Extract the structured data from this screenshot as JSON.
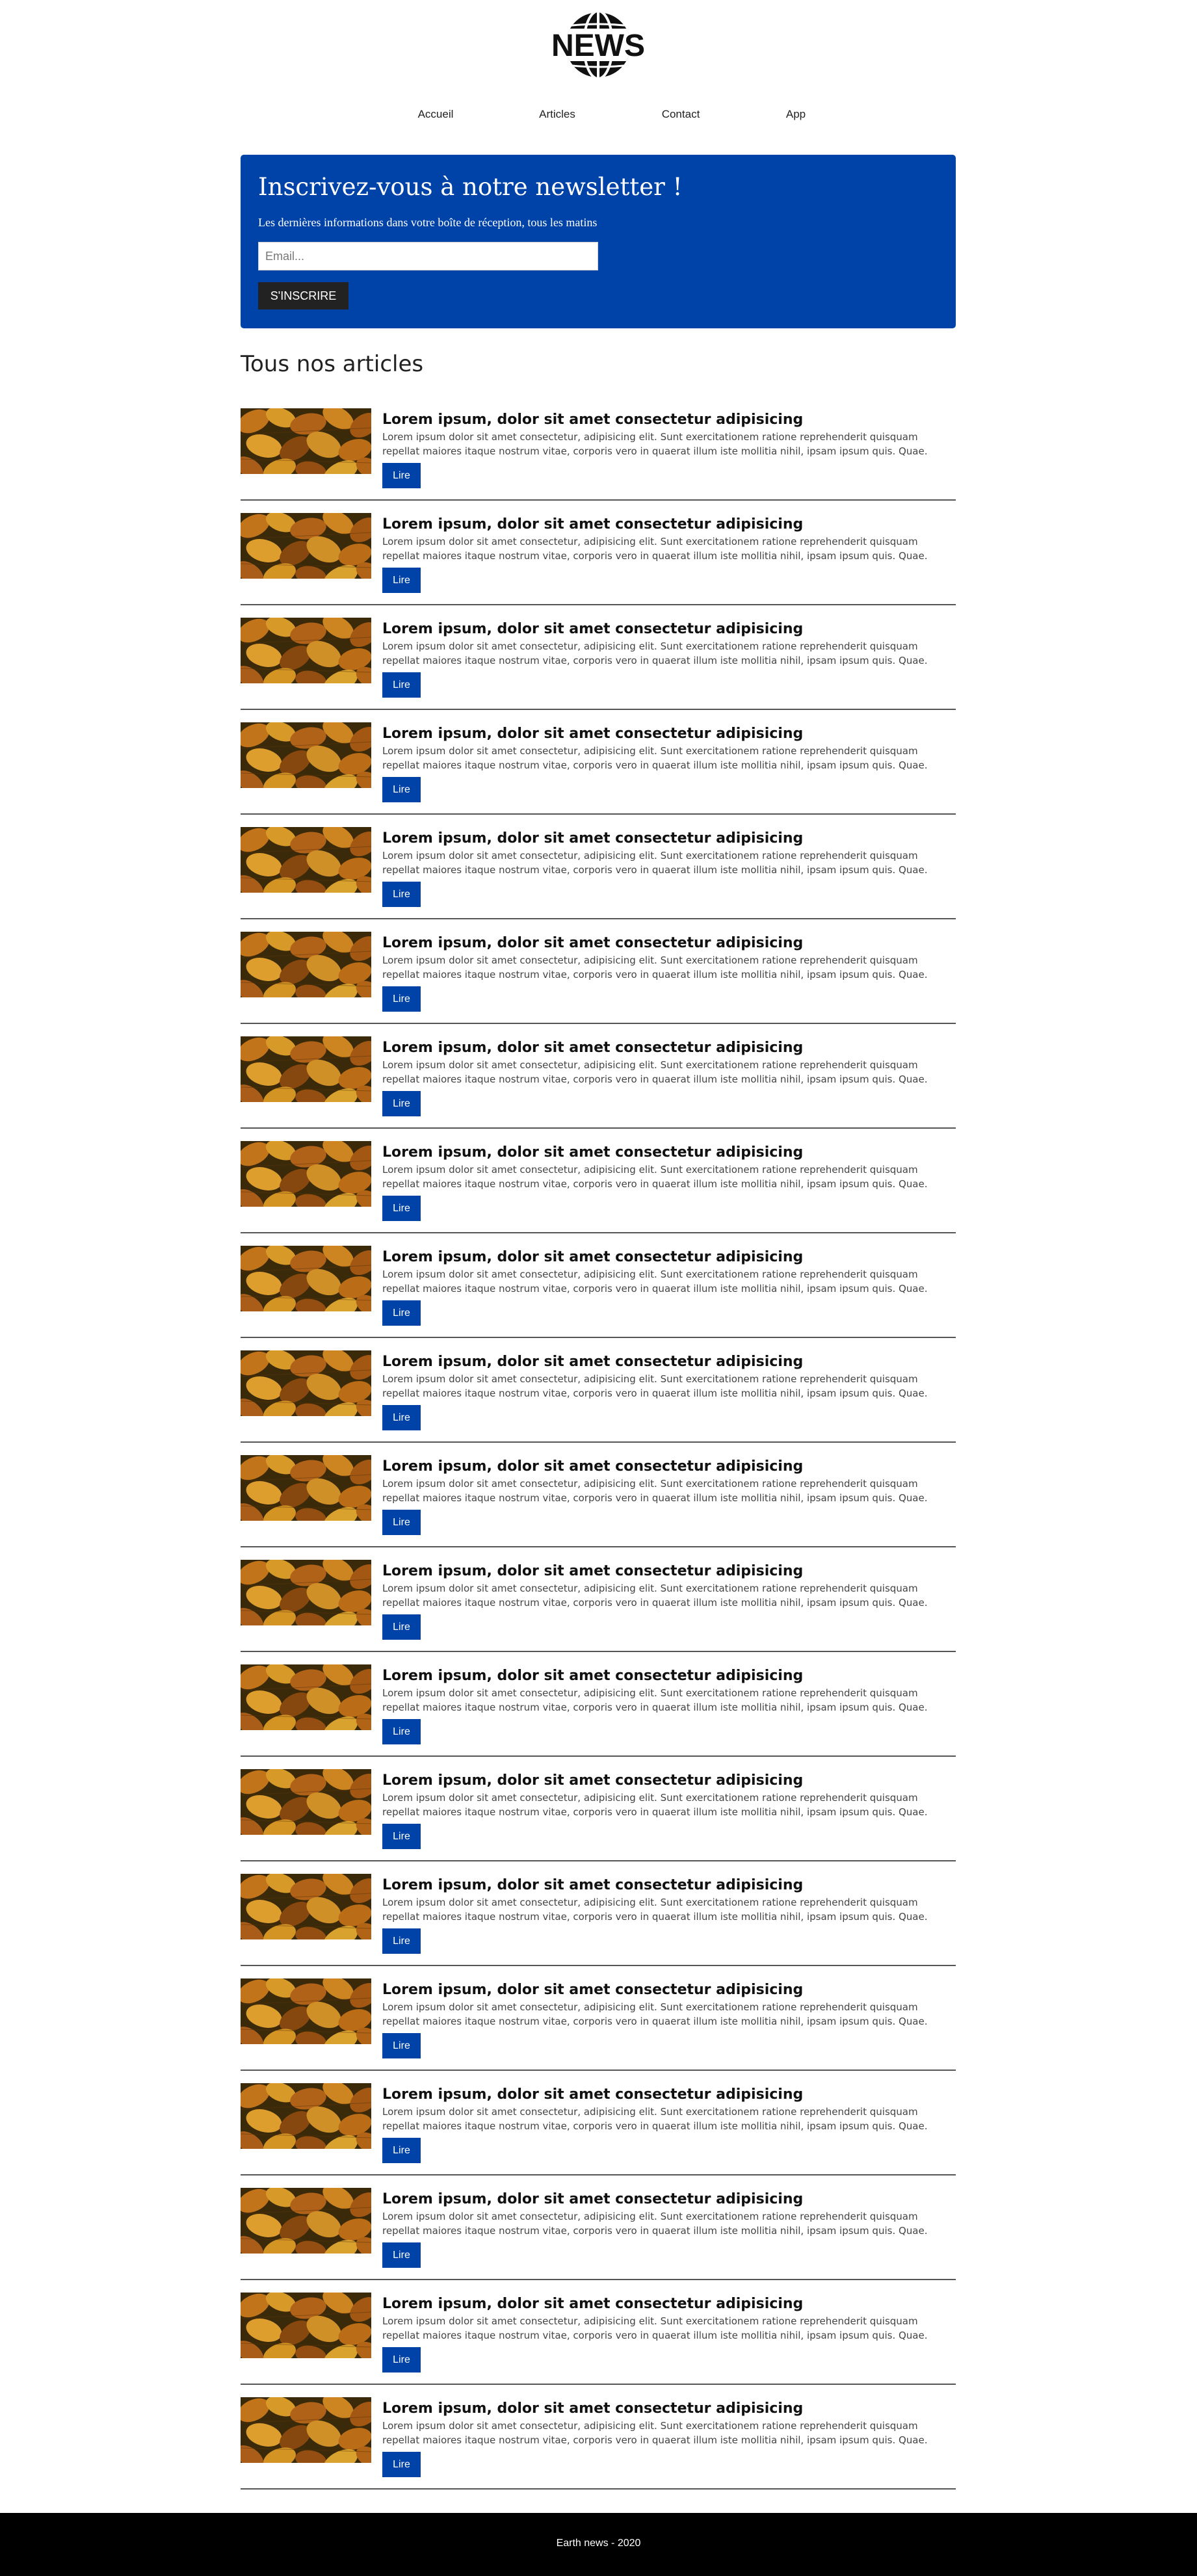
{
  "header": {
    "logo_text": "NEWS"
  },
  "nav": {
    "items": [
      {
        "label": "Accueil"
      },
      {
        "label": "Articles"
      },
      {
        "label": "Contact"
      },
      {
        "label": "App"
      }
    ]
  },
  "newsletter": {
    "title": "Inscrivez-vous à notre newsletter !",
    "subtitle": "Les dernières informations dans votre boîte de réception, tous les matins",
    "email_placeholder": "Email...",
    "subscribe_label": "S'INSCRIRE"
  },
  "articles_section": {
    "title": "Tous nos articles"
  },
  "articles": [
    {
      "title": "Lorem ipsum, dolor sit amet consectetur adipisicing",
      "excerpt": "Lorem ipsum dolor sit amet consectetur, adipisicing elit. Sunt exercitationem ratione reprehenderit quisquam repellat maiores itaque nostrum vitae, corporis vero in quaerat illum iste mollitia nihil, ipsam ipsum quis. Quae.",
      "button": "Lire"
    },
    {
      "title": "Lorem ipsum, dolor sit amet consectetur adipisicing",
      "excerpt": "Lorem ipsum dolor sit amet consectetur, adipisicing elit. Sunt exercitationem ratione reprehenderit quisquam repellat maiores itaque nostrum vitae, corporis vero in quaerat illum iste mollitia nihil, ipsam ipsum quis. Quae.",
      "button": "Lire"
    },
    {
      "title": "Lorem ipsum, dolor sit amet consectetur adipisicing",
      "excerpt": "Lorem ipsum dolor sit amet consectetur, adipisicing elit. Sunt exercitationem ratione reprehenderit quisquam repellat maiores itaque nostrum vitae, corporis vero in quaerat illum iste mollitia nihil, ipsam ipsum quis. Quae.",
      "button": "Lire"
    },
    {
      "title": "Lorem ipsum, dolor sit amet consectetur adipisicing",
      "excerpt": "Lorem ipsum dolor sit amet consectetur, adipisicing elit. Sunt exercitationem ratione reprehenderit quisquam repellat maiores itaque nostrum vitae, corporis vero in quaerat illum iste mollitia nihil, ipsam ipsum quis. Quae.",
      "button": "Lire"
    },
    {
      "title": "Lorem ipsum, dolor sit amet consectetur adipisicing",
      "excerpt": "Lorem ipsum dolor sit amet consectetur, adipisicing elit. Sunt exercitationem ratione reprehenderit quisquam repellat maiores itaque nostrum vitae, corporis vero in quaerat illum iste mollitia nihil, ipsam ipsum quis. Quae.",
      "button": "Lire"
    },
    {
      "title": "Lorem ipsum, dolor sit amet consectetur adipisicing",
      "excerpt": "Lorem ipsum dolor sit amet consectetur, adipisicing elit. Sunt exercitationem ratione reprehenderit quisquam repellat maiores itaque nostrum vitae, corporis vero in quaerat illum iste mollitia nihil, ipsam ipsum quis. Quae.",
      "button": "Lire"
    },
    {
      "title": "Lorem ipsum, dolor sit amet consectetur adipisicing",
      "excerpt": "Lorem ipsum dolor sit amet consectetur, adipisicing elit. Sunt exercitationem ratione reprehenderit quisquam repellat maiores itaque nostrum vitae, corporis vero in quaerat illum iste mollitia nihil, ipsam ipsum quis. Quae.",
      "button": "Lire"
    },
    {
      "title": "Lorem ipsum, dolor sit amet consectetur adipisicing",
      "excerpt": "Lorem ipsum dolor sit amet consectetur, adipisicing elit. Sunt exercitationem ratione reprehenderit quisquam repellat maiores itaque nostrum vitae, corporis vero in quaerat illum iste mollitia nihil, ipsam ipsum quis. Quae.",
      "button": "Lire"
    },
    {
      "title": "Lorem ipsum, dolor sit amet consectetur adipisicing",
      "excerpt": "Lorem ipsum dolor sit amet consectetur, adipisicing elit. Sunt exercitationem ratione reprehenderit quisquam repellat maiores itaque nostrum vitae, corporis vero in quaerat illum iste mollitia nihil, ipsam ipsum quis. Quae.",
      "button": "Lire"
    },
    {
      "title": "Lorem ipsum, dolor sit amet consectetur adipisicing",
      "excerpt": "Lorem ipsum dolor sit amet consectetur, adipisicing elit. Sunt exercitationem ratione reprehenderit quisquam repellat maiores itaque nostrum vitae, corporis vero in quaerat illum iste mollitia nihil, ipsam ipsum quis. Quae.",
      "button": "Lire"
    },
    {
      "title": "Lorem ipsum, dolor sit amet consectetur adipisicing",
      "excerpt": "Lorem ipsum dolor sit amet consectetur, adipisicing elit. Sunt exercitationem ratione reprehenderit quisquam repellat maiores itaque nostrum vitae, corporis vero in quaerat illum iste mollitia nihil, ipsam ipsum quis. Quae.",
      "button": "Lire"
    },
    {
      "title": "Lorem ipsum, dolor sit amet consectetur adipisicing",
      "excerpt": "Lorem ipsum dolor sit amet consectetur, adipisicing elit. Sunt exercitationem ratione reprehenderit quisquam repellat maiores itaque nostrum vitae, corporis vero in quaerat illum iste mollitia nihil, ipsam ipsum quis. Quae.",
      "button": "Lire"
    },
    {
      "title": "Lorem ipsum, dolor sit amet consectetur adipisicing",
      "excerpt": "Lorem ipsum dolor sit amet consectetur, adipisicing elit. Sunt exercitationem ratione reprehenderit quisquam repellat maiores itaque nostrum vitae, corporis vero in quaerat illum iste mollitia nihil, ipsam ipsum quis. Quae.",
      "button": "Lire"
    },
    {
      "title": "Lorem ipsum, dolor sit amet consectetur adipisicing",
      "excerpt": "Lorem ipsum dolor sit amet consectetur, adipisicing elit. Sunt exercitationem ratione reprehenderit quisquam repellat maiores itaque nostrum vitae, corporis vero in quaerat illum iste mollitia nihil, ipsam ipsum quis. Quae.",
      "button": "Lire"
    },
    {
      "title": "Lorem ipsum, dolor sit amet consectetur adipisicing",
      "excerpt": "Lorem ipsum dolor sit amet consectetur, adipisicing elit. Sunt exercitationem ratione reprehenderit quisquam repellat maiores itaque nostrum vitae, corporis vero in quaerat illum iste mollitia nihil, ipsam ipsum quis. Quae.",
      "button": "Lire"
    },
    {
      "title": "Lorem ipsum, dolor sit amet consectetur adipisicing",
      "excerpt": "Lorem ipsum dolor sit amet consectetur, adipisicing elit. Sunt exercitationem ratione reprehenderit quisquam repellat maiores itaque nostrum vitae, corporis vero in quaerat illum iste mollitia nihil, ipsam ipsum quis. Quae.",
      "button": "Lire"
    },
    {
      "title": "Lorem ipsum, dolor sit amet consectetur adipisicing",
      "excerpt": "Lorem ipsum dolor sit amet consectetur, adipisicing elit. Sunt exercitationem ratione reprehenderit quisquam repellat maiores itaque nostrum vitae, corporis vero in quaerat illum iste mollitia nihil, ipsam ipsum quis. Quae.",
      "button": "Lire"
    },
    {
      "title": "Lorem ipsum, dolor sit amet consectetur adipisicing",
      "excerpt": "Lorem ipsum dolor sit amet consectetur, adipisicing elit. Sunt exercitationem ratione reprehenderit quisquam repellat maiores itaque nostrum vitae, corporis vero in quaerat illum iste mollitia nihil, ipsam ipsum quis. Quae.",
      "button": "Lire"
    },
    {
      "title": "Lorem ipsum, dolor sit amet consectetur adipisicing",
      "excerpt": "Lorem ipsum dolor sit amet consectetur, adipisicing elit. Sunt exercitationem ratione reprehenderit quisquam repellat maiores itaque nostrum vitae, corporis vero in quaerat illum iste mollitia nihil, ipsam ipsum quis. Quae.",
      "button": "Lire"
    },
    {
      "title": "Lorem ipsum, dolor sit amet consectetur adipisicing",
      "excerpt": "Lorem ipsum dolor sit amet consectetur, adipisicing elit. Sunt exercitationem ratione reprehenderit quisquam repellat maiores itaque nostrum vitae, corporis vero in quaerat illum iste mollitia nihil, ipsam ipsum quis. Quae.",
      "button": "Lire"
    }
  ],
  "footer": {
    "text": "Earth news - 2020"
  },
  "colors": {
    "accent": "#0043a8",
    "footer_bg": "#000000",
    "button_dark": "#222222"
  },
  "icons": {
    "logo": "globe-icon",
    "thumbnail": "autumn-leaves-image"
  }
}
